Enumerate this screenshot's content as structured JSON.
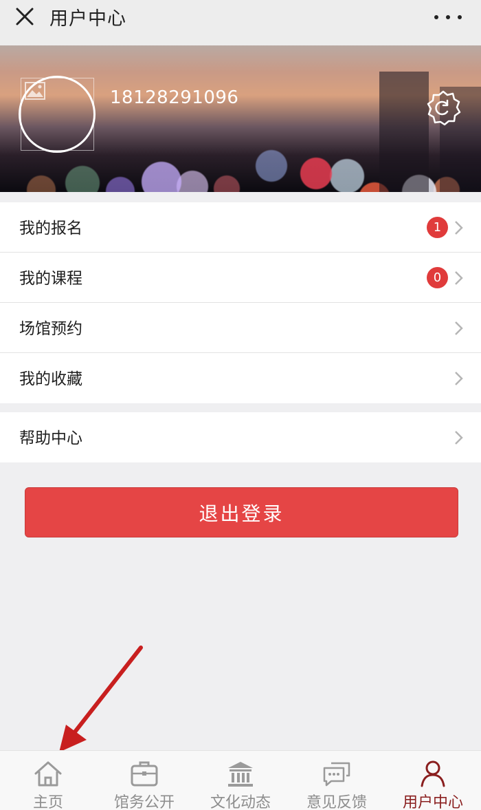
{
  "header": {
    "title": "用户中心"
  },
  "profile": {
    "phone": "18128291096"
  },
  "menu": {
    "group1": [
      {
        "label": "我的报名",
        "badge": "1"
      },
      {
        "label": "我的课程",
        "badge": "0"
      },
      {
        "label": "场馆预约"
      },
      {
        "label": "我的收藏"
      }
    ],
    "group2": [
      {
        "label": "帮助中心"
      }
    ]
  },
  "logout": {
    "label": "退出登录"
  },
  "tabbar": {
    "tabs": [
      {
        "label": "主页",
        "icon": "home-icon"
      },
      {
        "label": "馆务公开",
        "icon": "briefcase-icon"
      },
      {
        "label": "文化动态",
        "icon": "building-icon"
      },
      {
        "label": "意见反馈",
        "icon": "chat-icon"
      },
      {
        "label": "用户中心",
        "icon": "user-icon",
        "active": true
      }
    ]
  },
  "colors": {
    "accent": "#e54545",
    "badge": "#e03b3b",
    "active_tab": "#8a1f1f",
    "annotation": "#d11f1f"
  }
}
